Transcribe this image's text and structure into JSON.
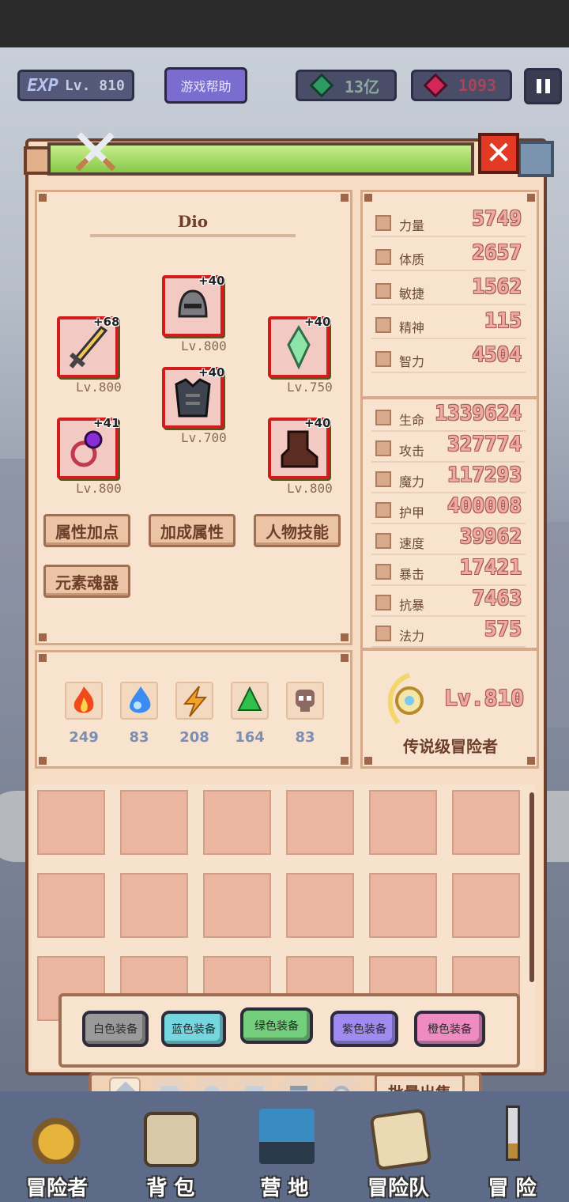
{
  "hud": {
    "exp_icon": "EXP",
    "level": "Lv. 810",
    "help": "游戏帮助",
    "gems": "13亿",
    "rubies": "1093",
    "pause_icon": "pause-icon"
  },
  "hero": {
    "name": "Dio",
    "equipment": [
      {
        "slot": "weapon",
        "plus": "+68",
        "level": "Lv.800"
      },
      {
        "slot": "helmet",
        "plus": "+40",
        "level": "Lv.800"
      },
      {
        "slot": "gem",
        "plus": "+40",
        "level": "Lv.750"
      },
      {
        "slot": "armor",
        "plus": "+40",
        "level": "Lv.700"
      },
      {
        "slot": "ring",
        "plus": "+41",
        "level": "Lv.800"
      },
      {
        "slot": "boots",
        "plus": "+40",
        "level": "Lv.800"
      }
    ],
    "buttons": [
      "属性加点",
      "加成属性",
      "人物技能",
      "元素魂器"
    ],
    "elements": [
      {
        "icon": "fire-icon",
        "value": "249"
      },
      {
        "icon": "water-icon",
        "value": "83"
      },
      {
        "icon": "lightning-icon",
        "value": "208"
      },
      {
        "icon": "poison-icon",
        "value": "164"
      },
      {
        "icon": "skull-icon",
        "value": "83"
      }
    ]
  },
  "stats_primary": [
    {
      "label": "力量",
      "value": "5749"
    },
    {
      "label": "体质",
      "value": "2657"
    },
    {
      "label": "敏捷",
      "value": "1562"
    },
    {
      "label": "精神",
      "value": "115"
    },
    {
      "label": "智力",
      "value": "4504"
    }
  ],
  "stats_secondary": [
    {
      "label": "生命",
      "value": "1339624"
    },
    {
      "label": "攻击",
      "value": "327774"
    },
    {
      "label": "魔力",
      "value": "117293"
    },
    {
      "label": "护甲",
      "value": "400008"
    },
    {
      "label": "速度",
      "value": "39962"
    },
    {
      "label": "暴击",
      "value": "17421"
    },
    {
      "label": "抗暴",
      "value": "7463"
    },
    {
      "label": "法力",
      "value": "575"
    }
  ],
  "rank": {
    "level": "Lv.810",
    "title": "传说级冒险者"
  },
  "filters": [
    {
      "label": "白色装备",
      "color": "#9a9a9a"
    },
    {
      "label": "蓝色装备",
      "color": "#74d7e0"
    },
    {
      "label": "绿色装备",
      "color": "#73cf7c"
    },
    {
      "label": "紫色装备",
      "color": "#9f8af0"
    },
    {
      "label": "橙色装备",
      "color": "#ee8cc2"
    }
  ],
  "bulk_sell": "批量出售",
  "nav": [
    {
      "label": "冒险者",
      "icon": "crown-helmet-icon"
    },
    {
      "label": "背 包",
      "icon": "backpack-icon"
    },
    {
      "label": "营 地",
      "icon": "camp-banner-icon"
    },
    {
      "label": "冒险队",
      "icon": "team-scroll-icon"
    },
    {
      "label": "冒 险",
      "icon": "sword-icon"
    }
  ]
}
